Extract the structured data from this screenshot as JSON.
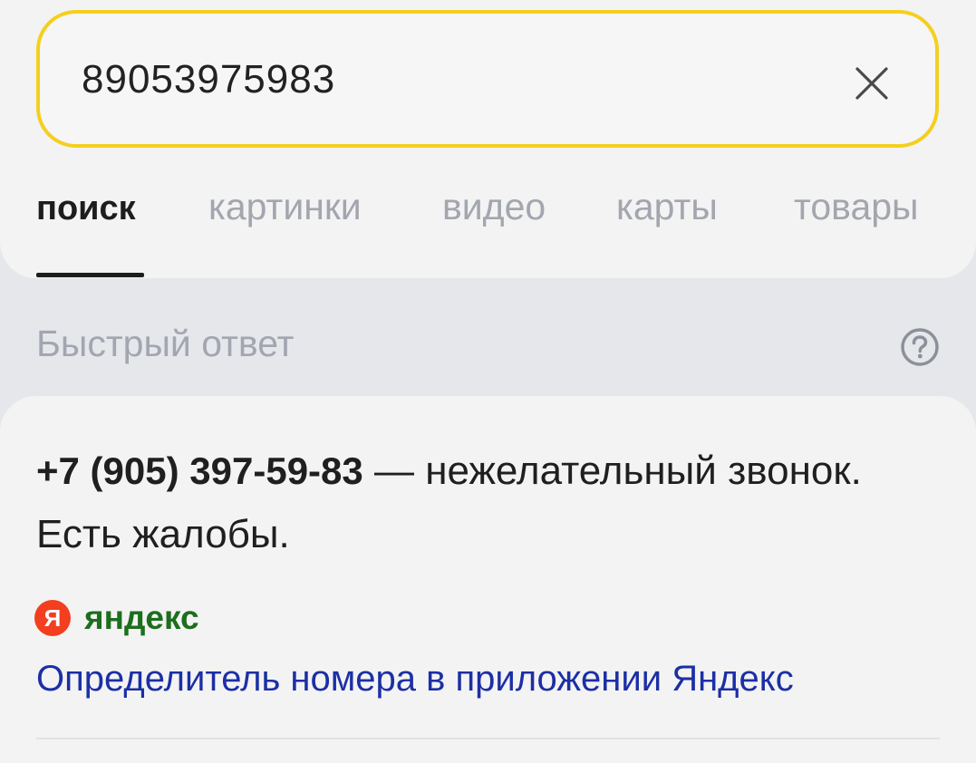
{
  "search": {
    "query": "89053975983",
    "clear_icon": "close-icon"
  },
  "tabs": [
    {
      "label": "поиск",
      "active": true
    },
    {
      "label": "картинки",
      "active": false
    },
    {
      "label": "видео",
      "active": false
    },
    {
      "label": "карты",
      "active": false
    },
    {
      "label": "товары",
      "active": false
    }
  ],
  "quick_answer": {
    "header": "Быстрый ответ",
    "help_icon": "question-circle-icon",
    "phone": "+7 (905) 397-59-83",
    "text": " — нежелательный звонок. Есть жалобы.",
    "source": {
      "logo_letter": "Я",
      "name": "яндекс"
    },
    "link": "Определитель номера в приложении Яндекс"
  },
  "colors": {
    "search_border": "#f4cf1f",
    "source_name": "#1d6e1d",
    "link": "#1c2fa5",
    "logo": "#f33e1f"
  }
}
